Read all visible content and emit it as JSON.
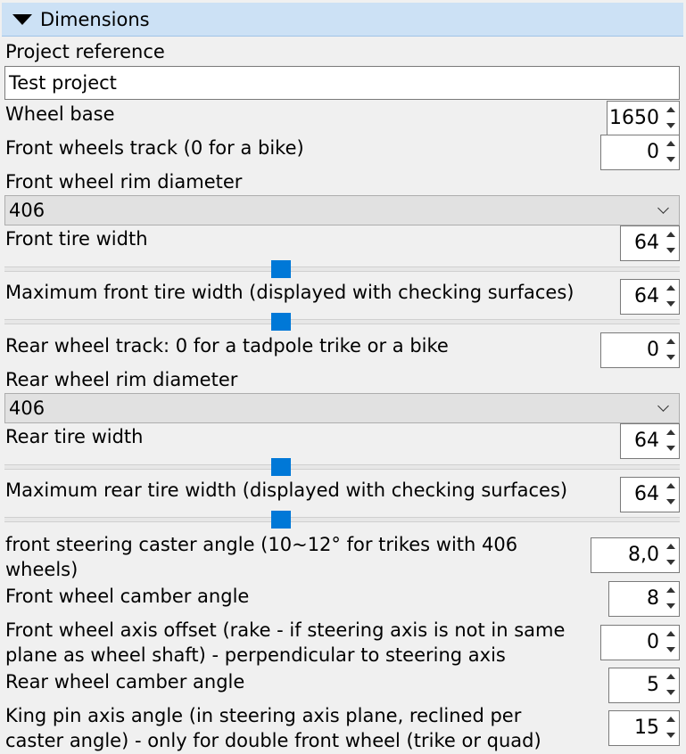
{
  "panel": {
    "title": "Dimensions"
  },
  "project": {
    "label": "Project reference",
    "value": "Test project"
  },
  "wheel_base": {
    "label": "Wheel base",
    "value": "1650"
  },
  "front_track": {
    "label": "Front wheels track (0 for a bike)",
    "value": "0"
  },
  "front_rim": {
    "label": "Front wheel rim diameter",
    "selected": "406"
  },
  "front_tire": {
    "label": "Front tire width",
    "value": "64",
    "slider_fraction": 0.41
  },
  "max_front_tire": {
    "label": "Maximum front tire width (displayed with checking surfaces)",
    "value": "64",
    "slider_fraction": 0.41
  },
  "rear_track": {
    "label": "Rear wheel track: 0 for a tadpole trike or a bike",
    "value": "0"
  },
  "rear_rim": {
    "label": "Rear wheel rim diameter",
    "selected": "406"
  },
  "rear_tire": {
    "label": "Rear tire width",
    "value": "64",
    "slider_fraction": 0.41
  },
  "max_rear_tire": {
    "label": "Maximum rear tire width (displayed with checking surfaces)",
    "value": "64",
    "slider_fraction": 0.41
  },
  "caster": {
    "label": "front steering caster angle (10~12° for trikes with 406 wheels)",
    "value": "8,0"
  },
  "front_camber": {
    "label": "Front wheel camber angle",
    "value": "8"
  },
  "axis_offset": {
    "label": "Front wheel axis offset (rake - if steering axis is not in same plane as wheel shaft) - perpendicular to steering axis",
    "value": "0"
  },
  "rear_camber": {
    "label": "Rear wheel camber angle",
    "value": "5"
  },
  "king_pin": {
    "label": "King pin axis angle (in steering axis plane, reclined per caster angle) - only for double front wheel (trike or quad)",
    "value": "15"
  },
  "colors": {
    "header_bg": "#cce1f5",
    "slider_thumb": "#0078d7",
    "panel_bg": "#f0f0f0"
  }
}
